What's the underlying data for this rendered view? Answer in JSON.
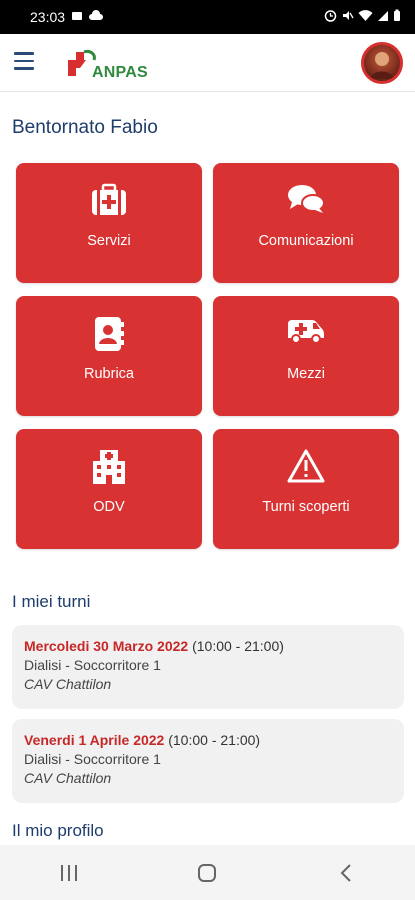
{
  "status_bar": {
    "time": "23:03",
    "icons": [
      "notification-icon",
      "cloud-icon",
      "alarm-icon",
      "mute-icon",
      "wifi-icon",
      "signal-icon",
      "battery-icon"
    ]
  },
  "header": {
    "logo_text": "ANPAS",
    "menu_icon": "hamburger-menu-icon",
    "avatar": "user-avatar"
  },
  "greeting": "Bentornato Fabio",
  "tiles": [
    {
      "label": "Servizi",
      "icon": "medical-bag-icon"
    },
    {
      "label": "Comunicazioni",
      "icon": "chat-bubbles-icon"
    },
    {
      "label": "Rubrica",
      "icon": "address-book-icon"
    },
    {
      "label": "Mezzi",
      "icon": "ambulance-icon"
    },
    {
      "label": "ODV",
      "icon": "hospital-icon"
    },
    {
      "label": "Turni scoperti",
      "icon": "warning-icon"
    }
  ],
  "shifts_section": {
    "title": "I miei turni",
    "items": [
      {
        "date": "Mercoledi 30 Marzo 2022",
        "time": "(10:00 - 21:00)",
        "role": "Dialisi - Soccorritore 1",
        "place": "CAV Chattilon"
      },
      {
        "date": "Venerdi 1 Aprile 2022",
        "time": "(10:00 - 21:00)",
        "role": "Dialisi - Soccorritore 1",
        "place": "CAV Chattilon"
      }
    ]
  },
  "profile_section": {
    "title": "Il mio profilo"
  },
  "navigation_bar": {
    "buttons": [
      "recent-apps-icon",
      "home-icon",
      "back-icon"
    ]
  },
  "colors": {
    "accent_red": "#d93232",
    "title_blue": "#1e3d6b",
    "logo_green": "#2f8a3c",
    "date_red": "#c62828"
  }
}
